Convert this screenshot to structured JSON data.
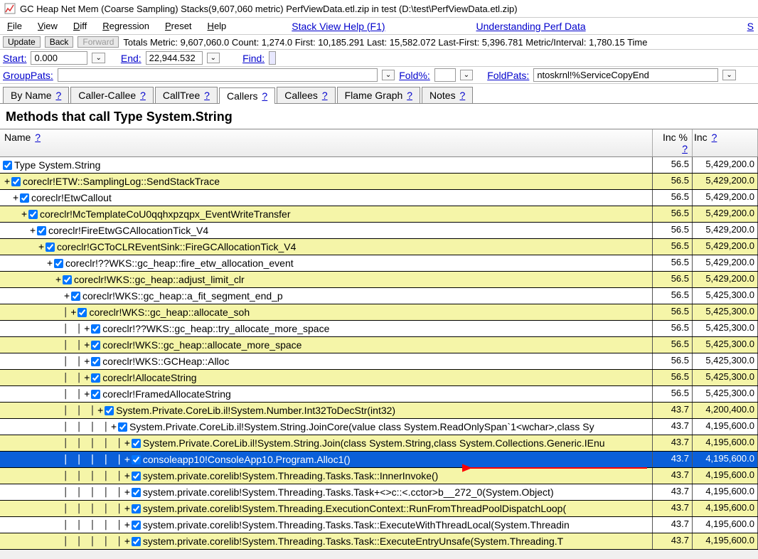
{
  "window": {
    "title": "GC Heap Net Mem (Coarse Sampling) Stacks(9,607,060 metric) PerfViewData.etl.zip in test (D:\\test\\PerfViewData.etl.zip)"
  },
  "menu": {
    "file": "File",
    "view": "View",
    "diff": "Diff",
    "regression": "Regression",
    "preset": "Preset",
    "help": "Help",
    "stack_help": "Stack View Help (F1)",
    "perf_data": "Understanding Perf Data",
    "extra": "S"
  },
  "toolbar": {
    "update": "Update",
    "back": "Back",
    "forward": "Forward",
    "totals": "Totals Metric: 9,607,060.0   Count: 1,274.0   First: 10,185.291  Last: 15,582.072   Last-First: 5,396.781   Metric/Interval: 1,780.15   Time"
  },
  "filters": {
    "start_label": "Start:",
    "start_value": "0.000",
    "end_label": "End:",
    "end_value": "22,944.532",
    "find_label": "Find:",
    "grouppats_label": "GroupPats:",
    "foldpct_label": "Fold%:",
    "foldpats_label": "FoldPats:",
    "foldpats_value": "ntoskrnl!%ServiceCopyEnd"
  },
  "tabs": {
    "byname": "By Name",
    "callercallee": "Caller-Callee",
    "calltree": "CallTree",
    "callers": "Callers",
    "callees": "Callees",
    "flamegraph": "Flame Graph",
    "notes": "Notes"
  },
  "section_title": "Methods that call Type System.String",
  "columns": {
    "name": "Name",
    "incp": "Inc %",
    "inc": "Inc"
  },
  "rows": [
    {
      "bg": "white",
      "indent": 0,
      "pre": "",
      "exp": "",
      "chk": true,
      "text": "Type System.String",
      "incp": "56.5",
      "inc": "5,429,200.0"
    },
    {
      "bg": "yellow",
      "indent": 0,
      "pre": "",
      "exp": "+",
      "chk": true,
      "text": "coreclr!ETW::SamplingLog::SendStackTrace",
      "incp": "56.5",
      "inc": "5,429,200.0"
    },
    {
      "bg": "white",
      "indent": 1,
      "pre": "",
      "exp": "+",
      "chk": true,
      "text": "coreclr!EtwCallout",
      "incp": "56.5",
      "inc": "5,429,200.0"
    },
    {
      "bg": "yellow",
      "indent": 2,
      "pre": "",
      "exp": "+",
      "chk": true,
      "text": "coreclr!McTemplateCoU0qqhxpzqpx_EventWriteTransfer",
      "incp": "56.5",
      "inc": "5,429,200.0"
    },
    {
      "bg": "white",
      "indent": 3,
      "pre": "",
      "exp": "+",
      "chk": true,
      "text": "coreclr!FireEtwGCAllocationTick_V4",
      "incp": "56.5",
      "inc": "5,429,200.0"
    },
    {
      "bg": "yellow",
      "indent": 4,
      "pre": "",
      "exp": "+",
      "chk": true,
      "text": "coreclr!GCToCLREventSink::FireGCAllocationTick_V4",
      "incp": "56.5",
      "inc": "5,429,200.0"
    },
    {
      "bg": "white",
      "indent": 5,
      "pre": "",
      "exp": "+",
      "chk": true,
      "text": "coreclr!??WKS::gc_heap::fire_etw_allocation_event",
      "incp": "56.5",
      "inc": "5,429,200.0"
    },
    {
      "bg": "yellow",
      "indent": 6,
      "pre": "",
      "exp": "+",
      "chk": true,
      "text": "coreclr!WKS::gc_heap::adjust_limit_clr",
      "incp": "56.5",
      "inc": "5,429,200.0"
    },
    {
      "bg": "white",
      "indent": 7,
      "pre": "",
      "exp": "+",
      "chk": true,
      "text": "coreclr!WKS::gc_heap::a_fit_segment_end_p",
      "incp": "56.5",
      "inc": "5,425,300.0"
    },
    {
      "bg": "yellow",
      "indent": 7,
      "pre": "|",
      "exp": "+",
      "chk": true,
      "text": "coreclr!WKS::gc_heap::allocate_soh",
      "incp": "56.5",
      "inc": "5,425,300.0"
    },
    {
      "bg": "white",
      "indent": 7,
      "pre": "| |",
      "exp": "+",
      "chk": true,
      "text": "coreclr!??WKS::gc_heap::try_allocate_more_space",
      "incp": "56.5",
      "inc": "5,425,300.0"
    },
    {
      "bg": "yellow",
      "indent": 7,
      "pre": "| | ",
      "exp": "+",
      "chk": true,
      "text": "coreclr!WKS::gc_heap::allocate_more_space",
      "incp": "56.5",
      "inc": "5,425,300.0"
    },
    {
      "bg": "white",
      "indent": 7,
      "pre": "| |  ",
      "exp": "+",
      "chk": true,
      "text": "coreclr!WKS::GCHeap::Alloc",
      "incp": "56.5",
      "inc": "5,425,300.0"
    },
    {
      "bg": "yellow",
      "indent": 7,
      "pre": "| |   ",
      "exp": "+",
      "chk": true,
      "text": "coreclr!AllocateString",
      "incp": "56.5",
      "inc": "5,425,300.0"
    },
    {
      "bg": "white",
      "indent": 7,
      "pre": "| |    ",
      "exp": "+",
      "chk": true,
      "text": "coreclr!FramedAllocateString",
      "incp": "56.5",
      "inc": "5,425,300.0"
    },
    {
      "bg": "yellow",
      "indent": 7,
      "pre": "| |    |",
      "exp": "+",
      "chk": true,
      "text": "System.Private.CoreLib.il!System.Number.Int32ToDecStr(int32)",
      "incp": "43.7",
      "inc": "4,200,400.0"
    },
    {
      "bg": "white",
      "indent": 7,
      "pre": "| |    | |",
      "exp": "+",
      "chk": true,
      "text": "System.Private.CoreLib.il!System.String.JoinCore(value class System.ReadOnlySpan`1<wchar>,class Sy",
      "incp": "43.7",
      "inc": "4,195,600.0"
    },
    {
      "bg": "yellow",
      "indent": 7,
      "pre": "| |    | | |",
      "exp": "+",
      "chk": true,
      "text": "System.Private.CoreLib.il!System.String.Join(class System.String,class System.Collections.Generic.IEnu",
      "incp": "43.7",
      "inc": "4,195,600.0"
    },
    {
      "bg": "selected",
      "indent": 7,
      "pre": "| |    | | |  ",
      "exp": "+",
      "chk": true,
      "text": "consoleapp10!ConsoleApp10.Program.Alloc1()",
      "incp": "43.7",
      "inc": "4,195,600.0"
    },
    {
      "bg": "yellow",
      "indent": 7,
      "pre": "| |    | | |   ",
      "exp": "+",
      "chk": true,
      "text": "system.private.corelib!System.Threading.Tasks.Task::InnerInvoke()",
      "incp": "43.7",
      "inc": "4,195,600.0"
    },
    {
      "bg": "white",
      "indent": 7,
      "pre": "| |    | | |    ",
      "exp": "+",
      "chk": true,
      "text": "system.private.corelib!System.Threading.Tasks.Task+<>c::<.cctor>b__272_0(System.Object)",
      "incp": "43.7",
      "inc": "4,195,600.0"
    },
    {
      "bg": "yellow",
      "indent": 7,
      "pre": "| |    | | |     ",
      "exp": "+",
      "chk": true,
      "text": "system.private.corelib!System.Threading.ExecutionContext::RunFromThreadPoolDispatchLoop(",
      "incp": "43.7",
      "inc": "4,195,600.0"
    },
    {
      "bg": "white",
      "indent": 7,
      "pre": "| |    | | |      ",
      "exp": "+",
      "chk": true,
      "text": "system.private.corelib!System.Threading.Tasks.Task::ExecuteWithThreadLocal(System.Threadin",
      "incp": "43.7",
      "inc": "4,195,600.0"
    },
    {
      "bg": "yellow",
      "indent": 7,
      "pre": "| |    | | |       ",
      "exp": "+",
      "chk": true,
      "text": "system.private.corelib!System.Threading.Tasks.Task::ExecuteEntryUnsafe(System.Threading.T",
      "incp": "43.7",
      "inc": "4,195,600.0"
    }
  ]
}
